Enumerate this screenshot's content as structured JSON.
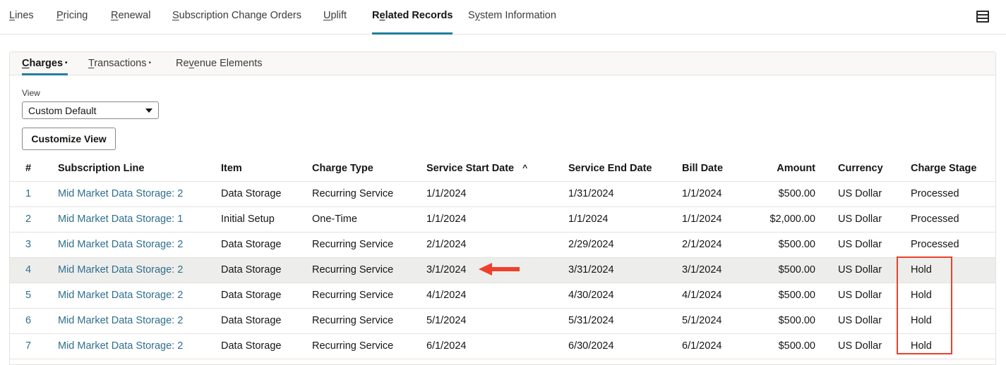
{
  "top_tabs": [
    {
      "label_pre": "",
      "label_key": "L",
      "label_post": "ines",
      "active": false
    },
    {
      "label_pre": "",
      "label_key": "P",
      "label_post": "ricing",
      "active": false
    },
    {
      "label_pre": "",
      "label_key": "R",
      "label_post": "enewal",
      "active": false
    },
    {
      "label_pre": "",
      "label_key": "S",
      "label_post": "ubscription Change Orders",
      "active": false
    },
    {
      "label_pre": "",
      "label_key": "U",
      "label_post": "plift",
      "active": false
    },
    {
      "label_pre": "R",
      "label_key": "e",
      "label_post": "lated Records",
      "active": true
    },
    {
      "label_pre": "S",
      "label_key": "y",
      "label_post": "stem Information",
      "active": false
    }
  ],
  "menu_icon": "list-view-icon",
  "sub_tabs": [
    {
      "label_pre": "",
      "label_key": "C",
      "label_post": "harges",
      "dot": "•",
      "active": true
    },
    {
      "label_pre": "",
      "label_key": "T",
      "label_post": "ransactions",
      "dot": "•",
      "active": false
    },
    {
      "label_pre": "Re",
      "label_key": "v",
      "label_post": "enue Elements",
      "dot": "",
      "active": false
    }
  ],
  "view": {
    "label": "View",
    "selected": "Custom Default"
  },
  "customize_button": "Customize View",
  "table": {
    "columns": [
      "#",
      "Subscription Line",
      "Item",
      "Charge Type",
      "Service Start Date",
      "Service End Date",
      "Bill Date",
      "Amount",
      "Currency",
      "Charge Stage"
    ],
    "sorted_column": "Service Start Date",
    "sort_direction": "ascending",
    "sort_glyph": "^",
    "rows": [
      {
        "num": "1",
        "line": "Mid Market Data Storage: 2",
        "item": "Data Storage",
        "type": "Recurring Service",
        "start": "1/1/2024",
        "end": "1/31/2024",
        "bill": "1/1/2024",
        "amount": "$500.00",
        "currency": "US Dollar",
        "stage": "Processed"
      },
      {
        "num": "2",
        "line": "Mid Market Data Storage: 1",
        "item": "Initial Setup",
        "type": "One-Time",
        "start": "1/1/2024",
        "end": "1/1/2024",
        "bill": "1/1/2024",
        "amount": "$2,000.00",
        "currency": "US Dollar",
        "stage": "Processed"
      },
      {
        "num": "3",
        "line": "Mid Market Data Storage: 2",
        "item": "Data Storage",
        "type": "Recurring Service",
        "start": "2/1/2024",
        "end": "2/29/2024",
        "bill": "2/1/2024",
        "amount": "$500.00",
        "currency": "US Dollar",
        "stage": "Processed"
      },
      {
        "num": "4",
        "line": "Mid Market Data Storage: 2",
        "item": "Data Storage",
        "type": "Recurring Service",
        "start": "3/1/2024",
        "end": "3/31/2024",
        "bill": "3/1/2024",
        "amount": "$500.00",
        "currency": "US Dollar",
        "stage": "Hold"
      },
      {
        "num": "5",
        "line": "Mid Market Data Storage: 2",
        "item": "Data Storage",
        "type": "Recurring Service",
        "start": "4/1/2024",
        "end": "4/30/2024",
        "bill": "4/1/2024",
        "amount": "$500.00",
        "currency": "US Dollar",
        "stage": "Hold"
      },
      {
        "num": "6",
        "line": "Mid Market Data Storage: 2",
        "item": "Data Storage",
        "type": "Recurring Service",
        "start": "5/1/2024",
        "end": "5/31/2024",
        "bill": "5/1/2024",
        "amount": "$500.00",
        "currency": "US Dollar",
        "stage": "Hold"
      },
      {
        "num": "7",
        "line": "Mid Market Data Storage: 2",
        "item": "Data Storage",
        "type": "Recurring Service",
        "start": "6/1/2024",
        "end": "6/30/2024",
        "bill": "6/1/2024",
        "amount": "$500.00",
        "currency": "US Dollar",
        "stage": "Hold"
      }
    ],
    "highlighted_row": "4"
  },
  "annotations": {
    "arrow_color": "#f0402b",
    "box_color": "#e8412c"
  },
  "colors": {
    "accent": "#227e9e",
    "link": "#2f6f8f",
    "row_highlight": "#ededeb"
  }
}
